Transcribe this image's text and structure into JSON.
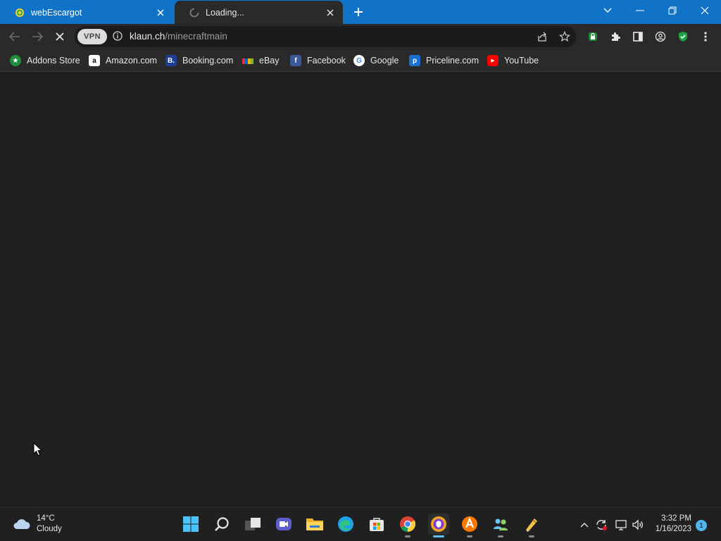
{
  "tabs": [
    {
      "title": "webEscargot",
      "favicon": "escargot-icon",
      "active": false
    },
    {
      "title": "Loading...",
      "favicon": "loading-spinner-icon",
      "active": true
    }
  ],
  "address": {
    "vpn_label": "VPN",
    "host": "klaun.ch",
    "path": "/minecraftmain"
  },
  "bookmarks": [
    {
      "label": "Addons Store",
      "icon": "addons-store-icon",
      "glyph": "★",
      "color": "#1e8e3e"
    },
    {
      "label": "Amazon.com",
      "icon": "amazon-icon",
      "glyph": "a",
      "color": "#ffffff"
    },
    {
      "label": "Booking.com",
      "icon": "booking-icon",
      "glyph": "B.",
      "color": "#1f3f91"
    },
    {
      "label": "eBay",
      "icon": "ebay-icon",
      "glyph": "",
      "color": "#e53238"
    },
    {
      "label": "Facebook",
      "icon": "facebook-icon",
      "glyph": "f",
      "color": "#3b5998"
    },
    {
      "label": "Google",
      "icon": "google-icon",
      "glyph": "G",
      "color": "#ffffff"
    },
    {
      "label": "Priceline.com",
      "icon": "priceline-icon",
      "glyph": "p",
      "color": "#1a6fd1"
    },
    {
      "label": "YouTube",
      "icon": "youtube-icon",
      "glyph": "▶",
      "color": "#ff0000"
    }
  ],
  "taskbar": {
    "weather_temp": "14°C",
    "weather_cond": "Cloudy",
    "time": "3:32 PM",
    "date": "1/16/2023",
    "notification_count": "1",
    "apps": [
      "start-icon",
      "search-icon",
      "task-view-icon",
      "teams-chat-icon",
      "file-explorer-icon",
      "edge-icon",
      "store-icon",
      "chrome-icon",
      "browser-vpn-icon",
      "avast-icon",
      "people-icon",
      "tool-icon"
    ]
  },
  "colors": {
    "accent": "#1073c7",
    "toolbar": "#2a2a2a",
    "page": "#1f1f1f"
  }
}
